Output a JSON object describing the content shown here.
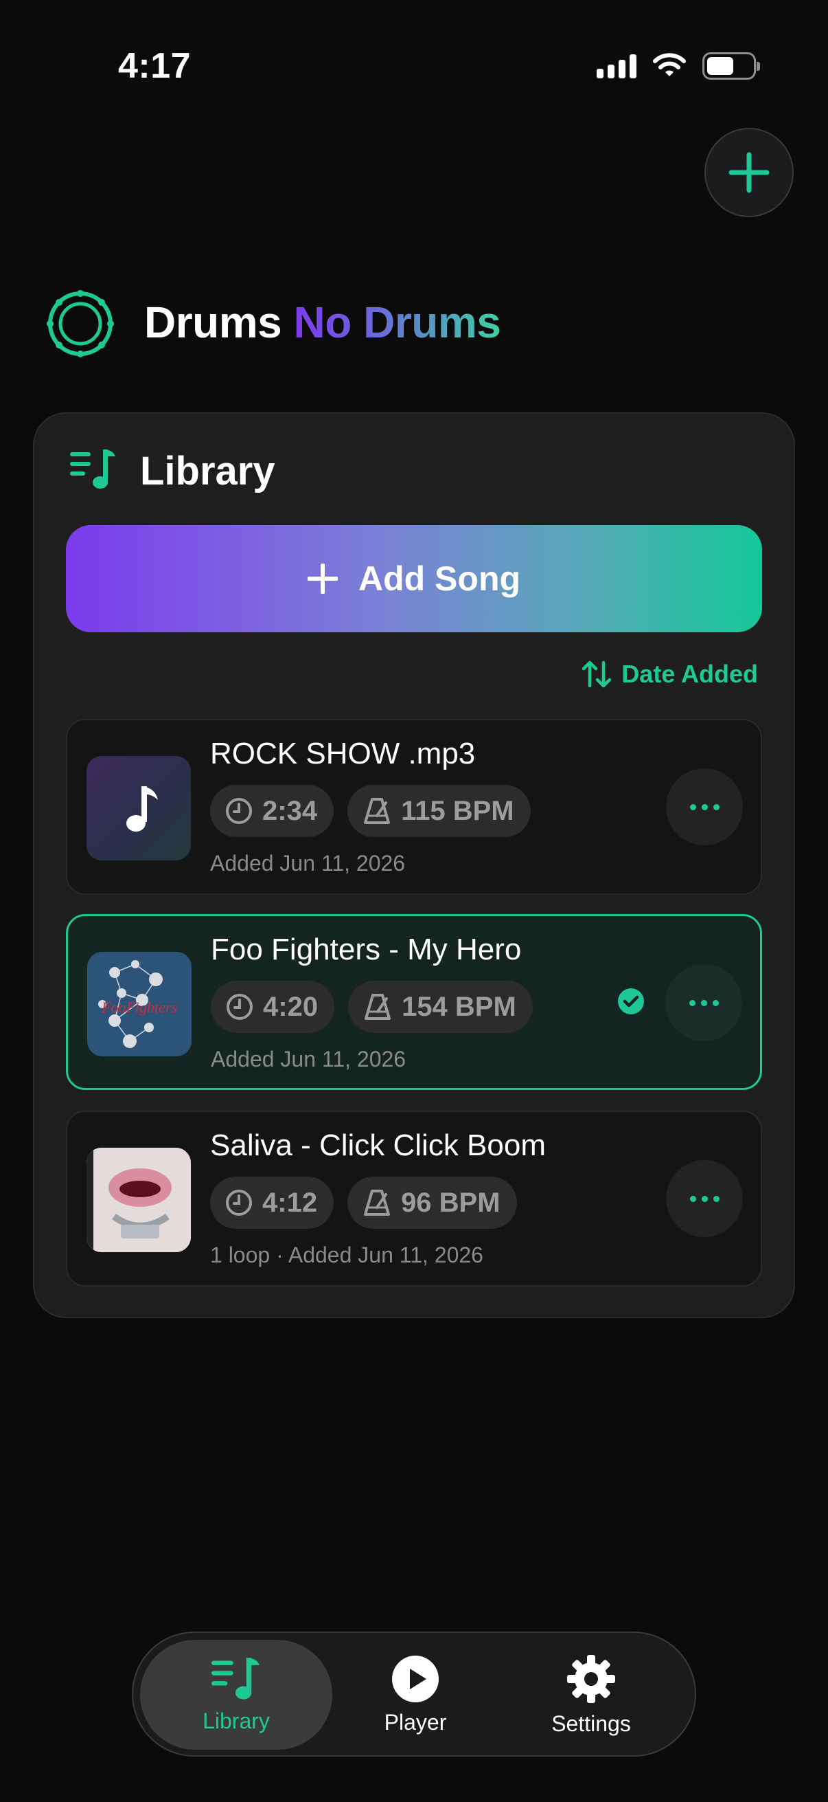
{
  "status_bar": {
    "time": "4:17"
  },
  "header": {
    "title_part1": "Drums",
    "title_part2": "No Drums",
    "add_icon": "plus-icon"
  },
  "library": {
    "title": "Library",
    "add_song_label": "Add Song",
    "sort_label": "Date Added",
    "songs": [
      {
        "title": "ROCK SHOW .mp3",
        "duration": "2:34",
        "bpm": "115 BPM",
        "meta": "Added Jun 11, 2026",
        "selected": false
      },
      {
        "title": "Foo Fighters - My Hero",
        "duration": "4:20",
        "bpm": "154 BPM",
        "meta": "Added Jun 11, 2026",
        "selected": true
      },
      {
        "title": "Saliva - Click Click Boom",
        "duration": "4:12",
        "bpm": "96 BPM",
        "meta": "1 loop · Added Jun 11, 2026",
        "selected": false
      }
    ]
  },
  "tabbar": {
    "tabs": [
      {
        "label": "Library",
        "icon": "library-music-icon",
        "active": true
      },
      {
        "label": "Player",
        "icon": "play-circle-icon",
        "active": false
      },
      {
        "label": "Settings",
        "icon": "gear-icon",
        "active": false
      }
    ]
  },
  "colors": {
    "accent": "#1fc994",
    "purple": "#7c3aed",
    "background": "#0b0b0b",
    "card": "#1e1e1e"
  }
}
